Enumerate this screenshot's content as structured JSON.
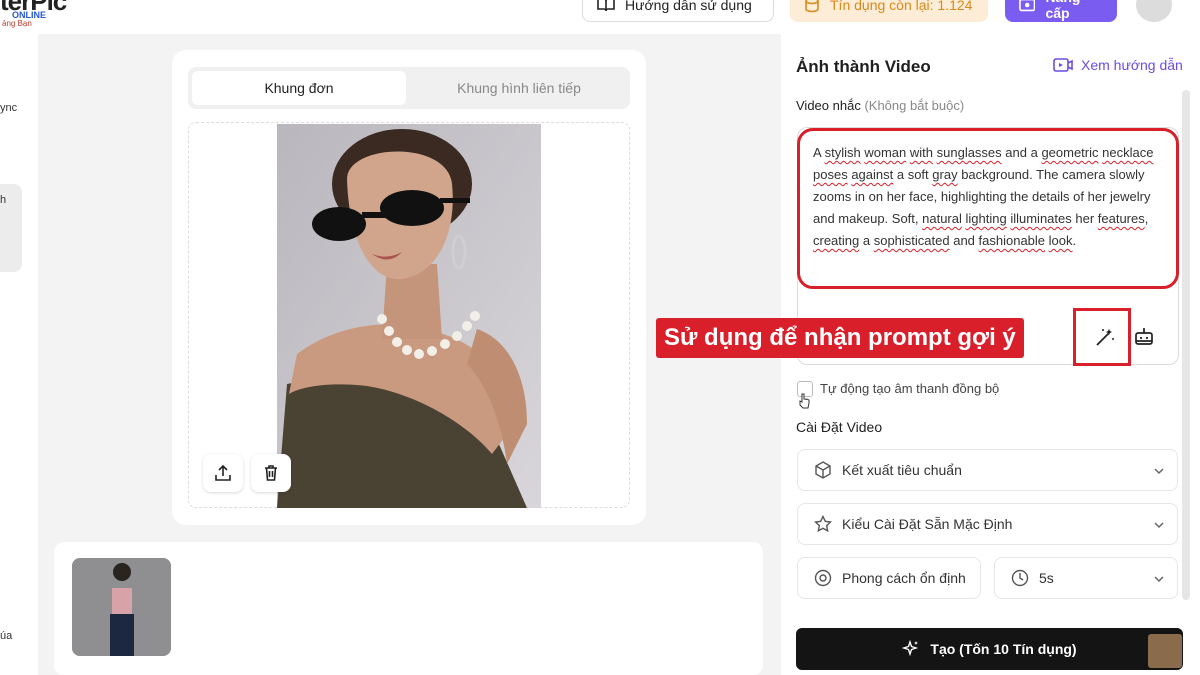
{
  "brand": {
    "logo_text": "terPic",
    "logo_online": "ONLINE",
    "logo_tagline": "ảng Bạn"
  },
  "topbar": {
    "guide_label": "Hướng dẫn sử dụng",
    "credits_label": "Tín dụng còn lại: 1.124",
    "upgrade_label": "Nâng cấp"
  },
  "sidebar": {
    "items": [
      {
        "label": "ync"
      },
      {
        "label": "h"
      },
      {
        "label": "úa"
      }
    ]
  },
  "editor": {
    "tabs": [
      {
        "label": "Khung đơn",
        "active": true
      },
      {
        "label": "Khung hình liên tiếp",
        "active": false
      }
    ],
    "upload_icon": "upload-icon",
    "delete_icon": "trash-icon"
  },
  "panel": {
    "title": "Ảnh thành Video",
    "guide_link": "Xem hướng dẫn",
    "prompt_label": "Video nhắc",
    "prompt_optional": "(Không bắt buộc)",
    "prompt_parts": [
      {
        "t": "A ",
        "s": false
      },
      {
        "t": "stylish",
        "s": true
      },
      {
        "t": " ",
        "s": false
      },
      {
        "t": "woman",
        "s": true
      },
      {
        "t": " ",
        "s": false
      },
      {
        "t": "with",
        "s": true
      },
      {
        "t": " ",
        "s": false
      },
      {
        "t": "sunglasses",
        "s": true
      },
      {
        "t": " and a ",
        "s": false
      },
      {
        "t": "geometric",
        "s": true
      },
      {
        "t": " ",
        "s": false
      },
      {
        "t": "necklace",
        "s": true
      },
      {
        "t": " ",
        "s": false
      },
      {
        "t": "poses",
        "s": true
      },
      {
        "t": " ",
        "s": false
      },
      {
        "t": "against",
        "s": true
      },
      {
        "t": " a soft ",
        "s": false
      },
      {
        "t": "gray",
        "s": true
      },
      {
        "t": " background. The camera slowly zooms in on her face, highlighting the details of her jewelry and makeup. Soft, ",
        "s": false
      },
      {
        "t": "natural",
        "s": true
      },
      {
        "t": " ",
        "s": false
      },
      {
        "t": "lighting",
        "s": true
      },
      {
        "t": " ",
        "s": false
      },
      {
        "t": "illuminates",
        "s": true
      },
      {
        "t": " her ",
        "s": false
      },
      {
        "t": "features",
        "s": true
      },
      {
        "t": ", ",
        "s": false
      },
      {
        "t": "creating",
        "s": true
      },
      {
        "t": " a ",
        "s": false
      },
      {
        "t": "sophisticated",
        "s": true
      },
      {
        "t": " and ",
        "s": false
      },
      {
        "t": "fashionable",
        "s": true
      },
      {
        "t": " ",
        "s": false
      },
      {
        "t": "look",
        "s": true
      },
      {
        "t": ".",
        "s": false
      }
    ],
    "callout": "Sử dụng để nhận prompt gợi ý",
    "auto_audio_label": "Tự động tạo âm thanh đồng bộ",
    "settings_title": "Cài Đặt Video",
    "render_mode": "Kết xuất tiêu chuẩn",
    "style_preset": "Kiểu Cài Đặt Sẵn Mặc Định",
    "camera_style": "Phong cách ổn định",
    "duration": "5s",
    "create_label": "Tạo (Tốn 10 Tín dụng)"
  },
  "colors": {
    "accent": "#7a5cf0",
    "highlight_red": "#d81f2a",
    "credit_orange": "#d88a1c"
  }
}
